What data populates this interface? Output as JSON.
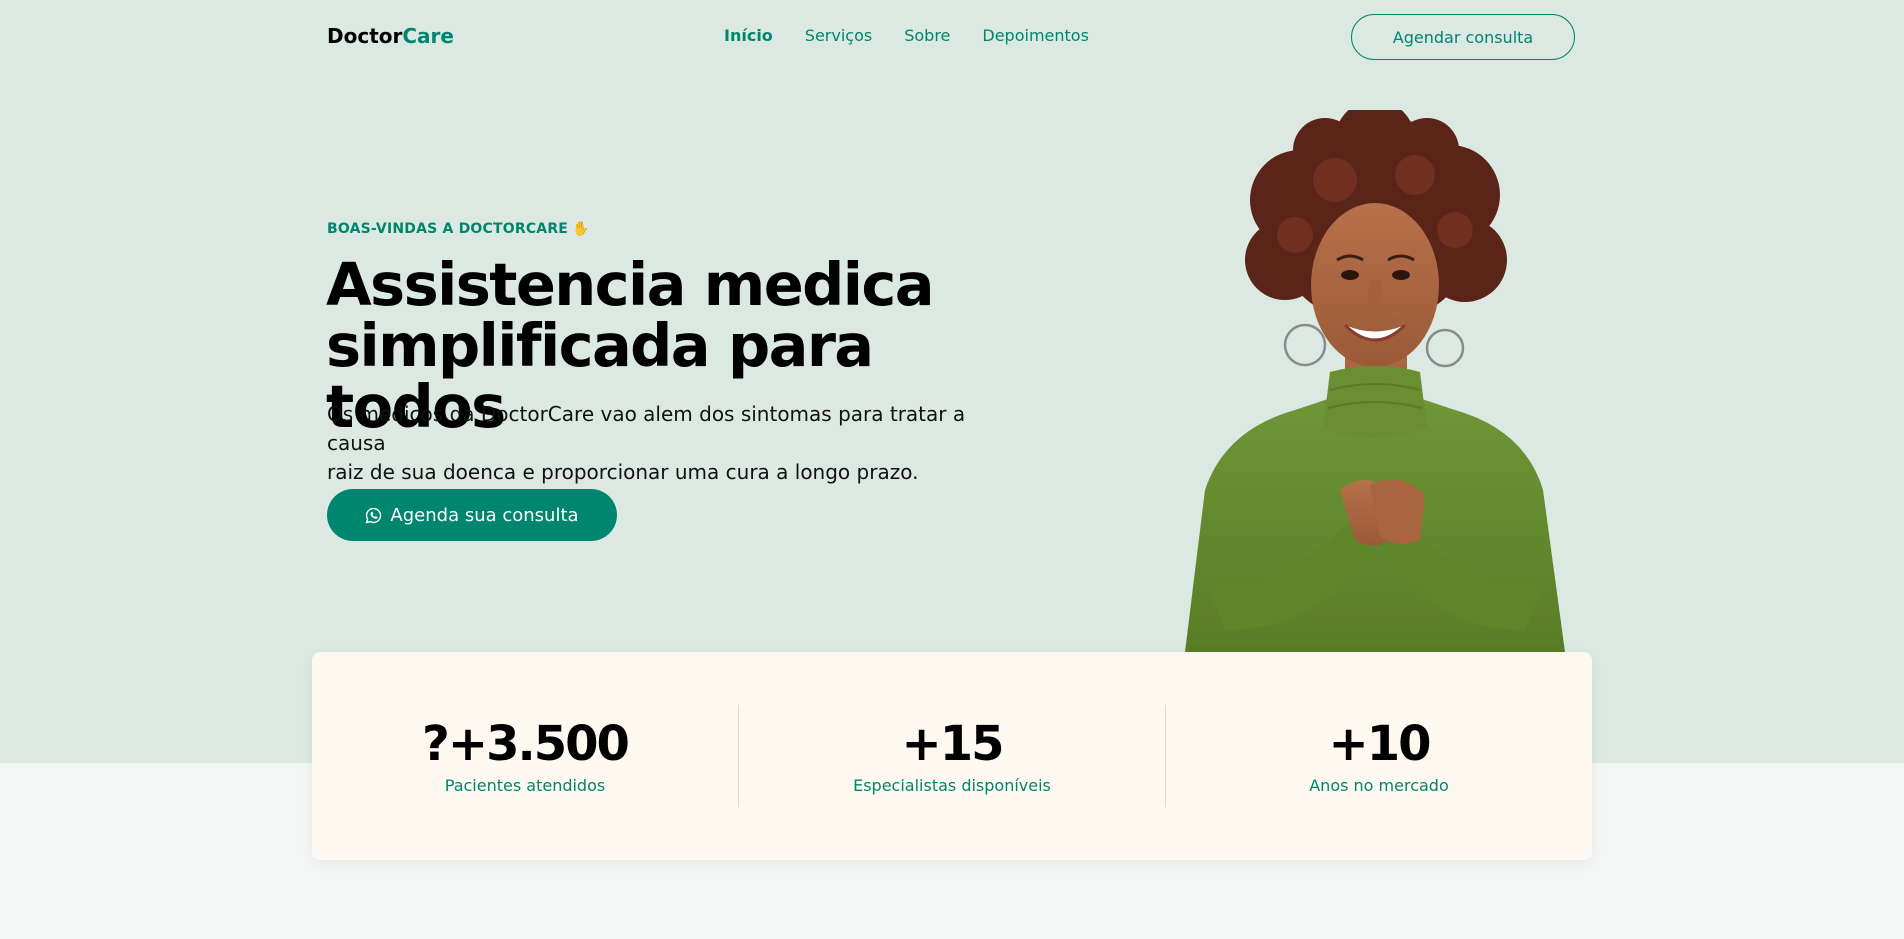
{
  "nav": {
    "logo_part1": "Doctor",
    "logo_part2": "Care",
    "items": [
      {
        "label": "Início",
        "active": true
      },
      {
        "label": "Serviços",
        "active": false
      },
      {
        "label": "Sobre",
        "active": false
      },
      {
        "label": "Depoimentos",
        "active": false
      }
    ],
    "cta_label": "Agendar consulta"
  },
  "hero": {
    "eyebrow": "BOAS-VINDAS A DOCTORCARE",
    "eyebrow_icon": "waving-hand-icon",
    "headline_line1": "Assistencia medica",
    "headline_line2": "simplificada para todos",
    "lede_line1": "Os medicos da DoctorCare vao alem dos sintomas para tratar a causa",
    "lede_line2": "raiz de sua doenca e proporcionar uma cura a longo prazo.",
    "cta_label": "Agenda sua consulta",
    "cta_icon": "whatsapp-icon"
  },
  "stats": [
    {
      "value": "?+3.500",
      "label": "Pacientes atendidos"
    },
    {
      "value": "+15",
      "label": "Especialistas disponíveis"
    },
    {
      "value": "+10",
      "label": "Anos no mercado"
    }
  ],
  "colors": {
    "accent": "#00856f",
    "hero_bg": "#dce9e2",
    "stats_bg": "#fdf8f0",
    "page_bg": "#f5f7f6"
  }
}
